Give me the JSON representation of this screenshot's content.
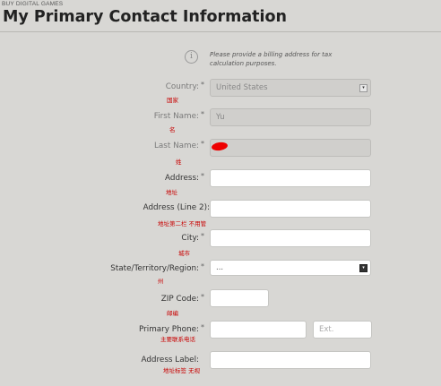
{
  "header": {
    "breadcrumb": "BUY DIGITAL GAMES",
    "title": "My Primary Contact Information"
  },
  "info": {
    "icon": "info-icon",
    "text": "Please provide a billing address for tax calculation purposes."
  },
  "form": {
    "country": {
      "label": "Country:",
      "required": "*",
      "note": "国家",
      "value": "United States"
    },
    "first_name": {
      "label": "First Name:",
      "required": "*",
      "note": "名",
      "value": "Yu"
    },
    "last_name": {
      "label": "Last Name:",
      "required": "*",
      "note": "姓",
      "value": ""
    },
    "address": {
      "label": "Address:",
      "required": "*",
      "note": "地址",
      "value": ""
    },
    "address2": {
      "label": "Address (Line 2):",
      "note": "地址第二栏  不用管",
      "value": ""
    },
    "city": {
      "label": "City:",
      "required": "*",
      "note": "城市",
      "value": ""
    },
    "state": {
      "label": "State/Territory/Region:",
      "required": "*",
      "note": "州",
      "value": "..."
    },
    "zip": {
      "label": "ZIP Code:",
      "required": "*",
      "note": "邮编",
      "value": ""
    },
    "phone": {
      "label": "Primary Phone:",
      "required": "*",
      "note": "主要联系电话",
      "value": "",
      "ext_placeholder": "Ext."
    },
    "address_label": {
      "label": "Address Label:",
      "note": "地址标签  无视",
      "value": ""
    }
  }
}
